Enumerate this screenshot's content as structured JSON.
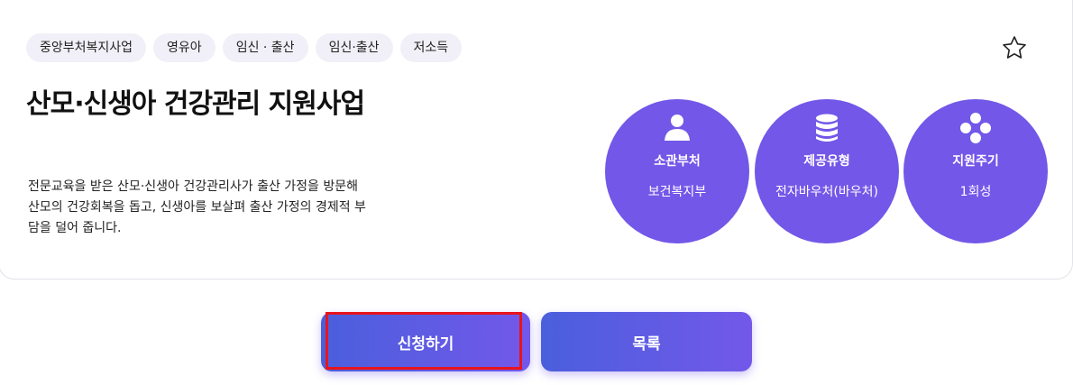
{
  "tags": [
    "중앙부처복지사업",
    "영유아",
    "임신 · 출산",
    "임신·출산",
    "저소득"
  ],
  "title": "산모·신생아 건강관리 지원사업",
  "description": "전문교육을 받은 산모·신생아 건강관리사가 출산 가정을 방문해 산모의 건강회복을 돕고, 신생아를 보살펴 출산 가정의 경제적 부담을 덜어 줍니다.",
  "info": [
    {
      "label": "소관부처",
      "value": "보건복지부",
      "icon": "user-icon"
    },
    {
      "label": "제공유형",
      "value": "전자바우처(바우처)",
      "icon": "database-icon"
    },
    {
      "label": "지원주기",
      "value": "1회성",
      "icon": "diamond-dots-icon"
    }
  ],
  "buttons": {
    "apply": "신청하기",
    "list": "목록"
  },
  "colors": {
    "accent": "#7357e8",
    "gradient_start": "#4a5fdc",
    "highlight": "#e8141c"
  }
}
